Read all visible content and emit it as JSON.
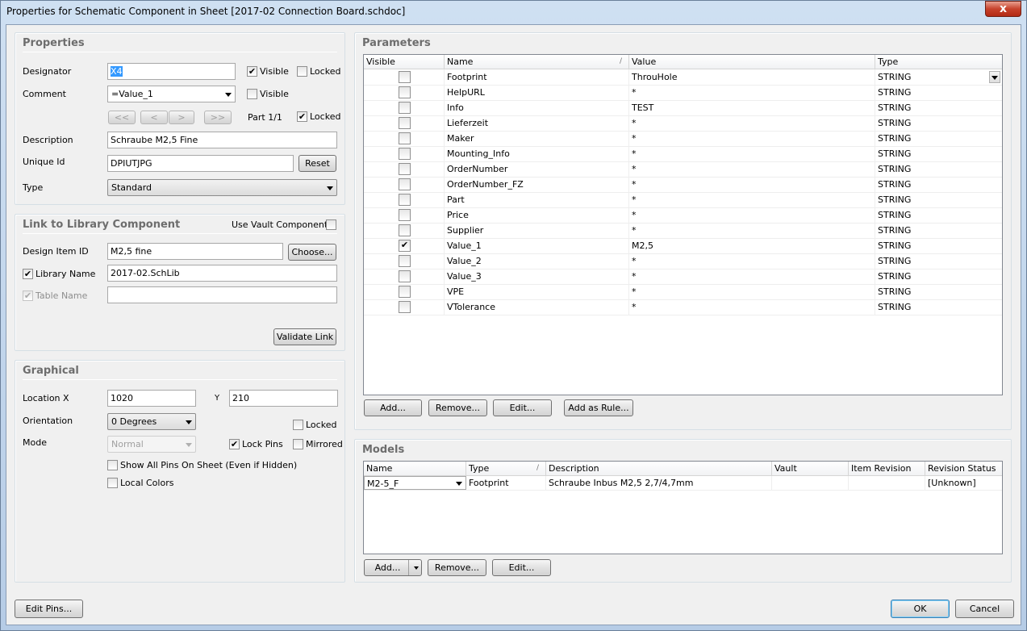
{
  "window": {
    "title": "Properties for Schematic Component in Sheet [2017-02 Connection Board.schdoc]",
    "close_glyph": "x"
  },
  "properties": {
    "title": "Properties",
    "designator_label": "Designator",
    "designator_value": "X4",
    "visible_label": "Visible",
    "locked_label": "Locked",
    "comment_label": "Comment",
    "comment_value": "=Value_1",
    "part_nav": [
      "<<",
      "<",
      ">",
      ">>"
    ],
    "part_label": "Part 1/1",
    "description_label": "Description",
    "description_value": "Schraube M2,5 Fine",
    "unique_id_label": "Unique Id",
    "unique_id_value": "DPIUTJPG",
    "reset_label": "Reset",
    "type_label": "Type",
    "type_value": "Standard"
  },
  "link": {
    "title": "Link to Library Component",
    "use_vault_label": "Use Vault Component",
    "design_item_label": "Design Item ID",
    "design_item_value": "M2,5 fine",
    "choose_label": "Choose...",
    "library_name_label": "Library Name",
    "library_name_value": "2017-02.SchLib",
    "table_name_label": "Table Name",
    "table_name_value": "",
    "validate_label": "Validate Link"
  },
  "graphical": {
    "title": "Graphical",
    "location_label": "Location",
    "x_label": "X",
    "x_value": "1020",
    "y_label": "Y",
    "y_value": "210",
    "orientation_label": "Orientation",
    "orientation_value": "0 Degrees",
    "locked_label": "Locked",
    "mode_label": "Mode",
    "mode_value": "Normal",
    "lock_pins_label": "Lock Pins",
    "mirrored_label": "Mirrored",
    "show_all_pins_label": "Show All Pins On Sheet (Even if Hidden)",
    "local_colors_label": "Local Colors"
  },
  "parameters": {
    "title": "Parameters",
    "columns": [
      "Visible",
      "Name",
      "Value",
      "Type"
    ],
    "rows": [
      {
        "visible": false,
        "name": "Footprint",
        "value": "ThrouHole",
        "type": "STRING"
      },
      {
        "visible": false,
        "name": "HelpURL",
        "value": "*",
        "type": "STRING"
      },
      {
        "visible": false,
        "name": "Info",
        "value": "TEST",
        "type": "STRING"
      },
      {
        "visible": false,
        "name": "Lieferzeit",
        "value": "*",
        "type": "STRING"
      },
      {
        "visible": false,
        "name": "Maker",
        "value": "*",
        "type": "STRING"
      },
      {
        "visible": false,
        "name": "Mounting_Info",
        "value": "*",
        "type": "STRING"
      },
      {
        "visible": false,
        "name": "OrderNumber",
        "value": "*",
        "type": "STRING"
      },
      {
        "visible": false,
        "name": "OrderNumber_FZ",
        "value": "*",
        "type": "STRING"
      },
      {
        "visible": false,
        "name": "Part",
        "value": "*",
        "type": "STRING"
      },
      {
        "visible": false,
        "name": "Price",
        "value": "*",
        "type": "STRING"
      },
      {
        "visible": false,
        "name": "Supplier",
        "value": "*",
        "type": "STRING"
      },
      {
        "visible": true,
        "name": "Value_1",
        "value": "M2,5",
        "type": "STRING"
      },
      {
        "visible": false,
        "name": "Value_2",
        "value": "*",
        "type": "STRING"
      },
      {
        "visible": false,
        "name": "Value_3",
        "value": "*",
        "type": "STRING"
      },
      {
        "visible": false,
        "name": "VPE",
        "value": "*",
        "type": "STRING"
      },
      {
        "visible": false,
        "name": "VTolerance",
        "value": "*",
        "type": "STRING"
      }
    ],
    "add_label": "Add...",
    "remove_label": "Remove...",
    "edit_label": "Edit...",
    "add_rule_label": "Add as Rule..."
  },
  "models": {
    "title": "Models",
    "columns": [
      "Name",
      "Type",
      "Description",
      "Vault",
      "Item Revision",
      "Revision Status"
    ],
    "rows": [
      {
        "name": "M2-5_F",
        "type": "Footprint",
        "description": "Schraube Inbus M2,5 2,7/4,7mm",
        "vault": "",
        "item_revision": "",
        "revision_status": "[Unknown]"
      }
    ],
    "add_label": "Add...",
    "remove_label": "Remove...",
    "edit_label": "Edit..."
  },
  "footer": {
    "edit_pins_label": "Edit Pins...",
    "ok_label": "OK",
    "cancel_label": "Cancel"
  }
}
